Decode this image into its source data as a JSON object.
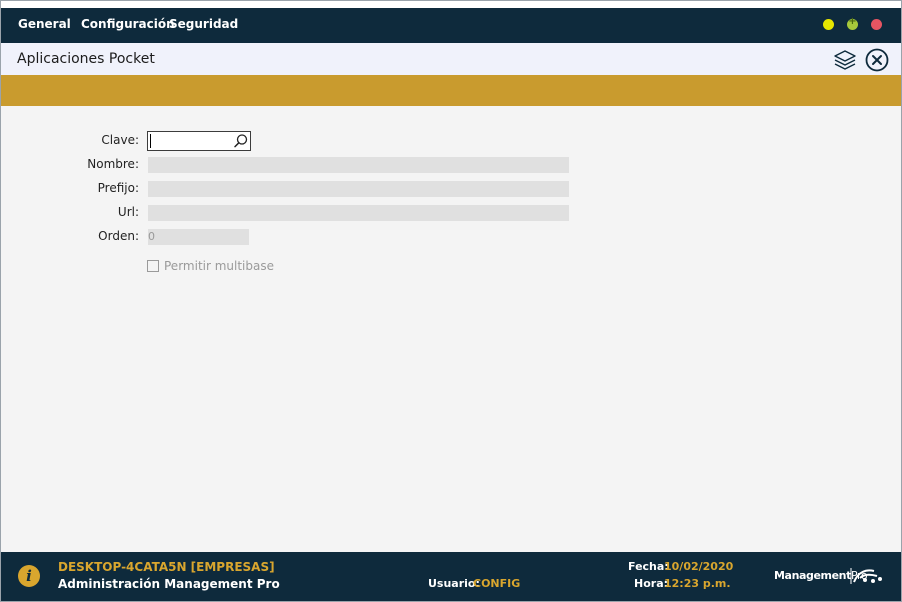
{
  "menu": {
    "items": [
      "General",
      "Configuración",
      "Seguridad"
    ]
  },
  "window_controls": {
    "maximize_symbol": "+"
  },
  "header": {
    "title": "Aplicaciones Pocket"
  },
  "form": {
    "clave_label": "Clave:",
    "clave_value": "",
    "nombre_label": "Nombre:",
    "prefijo_label": "Prefijo:",
    "url_label": "Url:",
    "orden_label": "Orden:",
    "orden_value": "0",
    "multibase_label": "Permitir multibase",
    "multibase_checked": false
  },
  "status": {
    "host": "DESKTOP-4CATA5N [EMPRESAS]",
    "app_name": "Administración Management Pro",
    "usuario_label": "Usuario:",
    "usuario_value": "CONFIG",
    "fecha_label": "Fecha:",
    "fecha_value": "10/02/2020",
    "hora_label": "Hora:",
    "hora_value": "12:23 p.m.",
    "brand_main": "Management",
    "brand_suffix": "Pro",
    "info_symbol": "i"
  },
  "colors": {
    "navy": "#0e2a3c",
    "gold": "#c99b2e",
    "status_accent": "#d9a62e",
    "background": "#f4f4f4"
  },
  "icons": {
    "layers": "layers-icon",
    "close": "close-circle-icon",
    "search": "search-icon",
    "info": "info-icon",
    "brand_mark": "management-pro-logo"
  }
}
